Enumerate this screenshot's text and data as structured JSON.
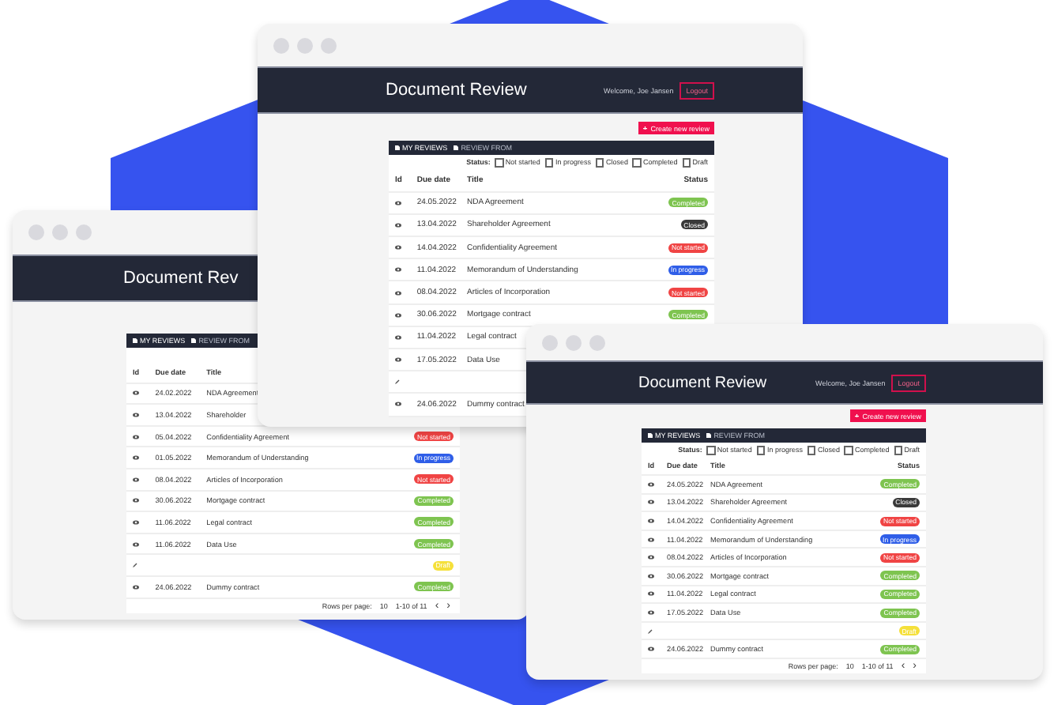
{
  "windows": [
    {
      "title": "Document Rev",
      "tabs": [
        {
          "label": "MY REVIEWS",
          "selected": true
        },
        {
          "label": "REVIEW FROM",
          "selected": false
        }
      ],
      "columns": [
        "Id",
        "Due date",
        "Title"
      ],
      "rows": [
        {
          "kind": "view",
          "date": "24.02.2022",
          "title": "NDA Agreement"
        },
        {
          "kind": "view",
          "date": "13.04.2022",
          "title": "Shareholder"
        },
        {
          "kind": "view",
          "date": "05.04.2022",
          "title": "Confidentiality Agreement",
          "status": {
            "label": "Not started",
            "color": "#f04444"
          }
        },
        {
          "kind": "view",
          "date": "01.05.2022",
          "title": "Memorandum of Understanding",
          "status": {
            "label": "In progress",
            "color": "#2f5ee8"
          }
        },
        {
          "kind": "view",
          "date": "08.04.2022",
          "title": "Articles of Incorporation",
          "status": {
            "label": "Not started",
            "color": "#f04444"
          }
        },
        {
          "kind": "view",
          "date": "30.06.2022",
          "title": "Mortgage contract",
          "status": {
            "label": "Completed",
            "color": "#7ec450"
          }
        },
        {
          "kind": "view",
          "date": "11.06.2022",
          "title": "Legal contract",
          "status": {
            "label": "Completed",
            "color": "#7ec450"
          }
        },
        {
          "kind": "view",
          "date": "11.06.2022",
          "title": "Data Use",
          "status": {
            "label": "Completed",
            "color": "#7ec450"
          }
        },
        {
          "kind": "edit",
          "status": {
            "label": "Draft",
            "color": "#f5e03a"
          }
        },
        {
          "kind": "view",
          "date": "24.06.2022",
          "title": "Dummy contract",
          "status": {
            "label": "Completed",
            "color": "#7ec450"
          }
        }
      ],
      "pagination": {
        "rows_per_page": "Rows per page:",
        "per_page": "10",
        "range": "1-10 of 11",
        "prev": "‹",
        "next": "›"
      }
    },
    {
      "title": "Document Review",
      "welcome": "Welcome, Joe Jansen",
      "logout": "Logout",
      "create": "Create new review",
      "tabs": [
        {
          "label": "MY REVIEWS",
          "selected": true
        },
        {
          "label": "REVIEW FROM",
          "selected": false
        }
      ],
      "filter": {
        "label": "Status:",
        "options": [
          {
            "label": "Not started",
            "checked": false
          },
          {
            "label": "In progress",
            "checked": false
          },
          {
            "label": "Closed",
            "checked": false
          },
          {
            "label": "Completed",
            "checked": false
          },
          {
            "label": "Draft",
            "checked": false
          }
        ]
      },
      "columns": [
        "Id",
        "Due date",
        "Title",
        "Status"
      ],
      "rows": [
        {
          "kind": "view",
          "date": "24.05.2022",
          "title": "NDA Agreement",
          "status": {
            "label": "Completed",
            "color": "#7ec450"
          }
        },
        {
          "kind": "view",
          "date": "13.04.2022",
          "title": "Shareholder Agreement",
          "status": {
            "label": "Closed",
            "color": "#3a3a3a"
          }
        },
        {
          "kind": "view",
          "date": "14.04.2022",
          "title": "Confidentiality Agreement",
          "status": {
            "label": "Not started",
            "color": "#f04444"
          }
        },
        {
          "kind": "view",
          "date": "11.04.2022",
          "title": "Memorandum of Understanding",
          "status": {
            "label": "In progress",
            "color": "#2f5ee8"
          }
        },
        {
          "kind": "view",
          "date": "08.04.2022",
          "title": "Articles of Incorporation",
          "status": {
            "label": "Not started",
            "color": "#f04444"
          }
        },
        {
          "kind": "view",
          "date": "30.06.2022",
          "title": "Mortgage contract",
          "status": {
            "label": "Completed",
            "color": "#7ec450"
          }
        },
        {
          "kind": "view",
          "date": "11.04.2022",
          "title": "Legal contract"
        },
        {
          "kind": "view",
          "date": "17.05.2022",
          "title": "Data Use"
        },
        {
          "kind": "edit"
        },
        {
          "kind": "view",
          "date": "24.06.2022",
          "title": "Dummy contract"
        }
      ]
    },
    {
      "title": "Document Review",
      "welcome": "Welcome, Joe Jansen",
      "logout": "Logout",
      "create": "Create new review",
      "tabs": [
        {
          "label": "MY REVIEWS",
          "selected": true
        },
        {
          "label": "REVIEW FROM",
          "selected": false
        }
      ],
      "filter": {
        "label": "Status:",
        "options": [
          {
            "label": "Not started",
            "checked": false
          },
          {
            "label": "In progress",
            "checked": false
          },
          {
            "label": "Closed",
            "checked": false
          },
          {
            "label": "Completed",
            "checked": false
          },
          {
            "label": "Draft",
            "checked": false
          }
        ]
      },
      "columns": [
        "Id",
        "Due date",
        "Title",
        "Status"
      ],
      "rows": [
        {
          "kind": "view",
          "date": "24.05.2022",
          "title": "NDA Agreement",
          "status": {
            "label": "Completed",
            "color": "#7ec450"
          }
        },
        {
          "kind": "view",
          "date": "13.04.2022",
          "title": "Shareholder Agreement",
          "status": {
            "label": "Closed",
            "color": "#3a3a3a"
          }
        },
        {
          "kind": "view",
          "date": "14.04.2022",
          "title": "Confidentiality Agreement",
          "status": {
            "label": "Not started",
            "color": "#f04444"
          }
        },
        {
          "kind": "view",
          "date": "11.04.2022",
          "title": "Memorandum of Understanding",
          "status": {
            "label": "In progress",
            "color": "#2f5ee8"
          }
        },
        {
          "kind": "view",
          "date": "08.04.2022",
          "title": "Articles of Incorporation",
          "status": {
            "label": "Not started",
            "color": "#f04444"
          }
        },
        {
          "kind": "view",
          "date": "30.06.2022",
          "title": "Mortgage contract",
          "status": {
            "label": "Completed",
            "color": "#7ec450"
          }
        },
        {
          "kind": "view",
          "date": "11.04.2022",
          "title": "Legal contract",
          "status": {
            "label": "Completed",
            "color": "#7ec450"
          }
        },
        {
          "kind": "view",
          "date": "17.05.2022",
          "title": "Data Use",
          "status": {
            "label": "Completed",
            "color": "#7ec450"
          }
        },
        {
          "kind": "edit",
          "status": {
            "label": "Draft",
            "color": "#f5e03a"
          }
        },
        {
          "kind": "view",
          "date": "24.06.2022",
          "title": "Dummy contract",
          "status": {
            "label": "Completed",
            "color": "#7ec450"
          }
        }
      ],
      "pagination": {
        "rows_per_page": "Rows per page:",
        "per_page": "10",
        "range": "1-10 of 11",
        "prev": "‹",
        "next": "›"
      }
    }
  ]
}
